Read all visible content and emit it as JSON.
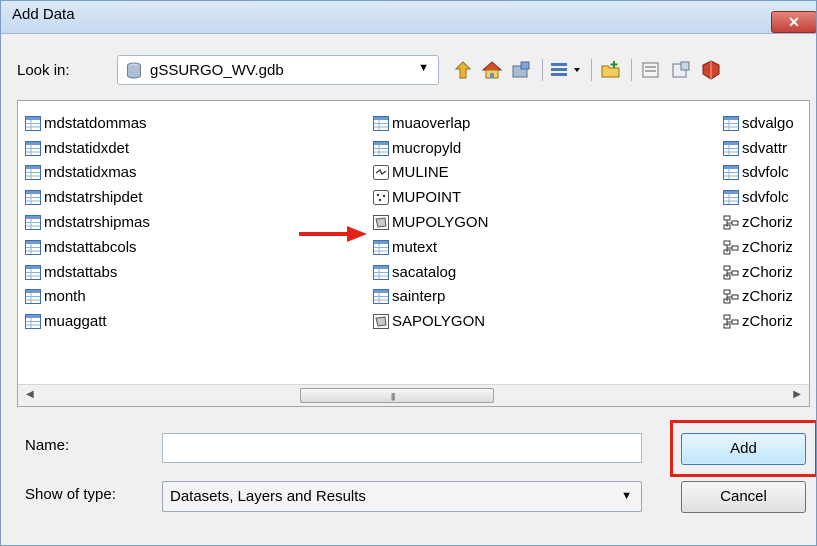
{
  "window": {
    "title": "Add Data",
    "close_glyph": "✕"
  },
  "lookin": {
    "label": "Look in:",
    "value": "gSSURGO_WV.gdb",
    "icon": "geodatabase-icon"
  },
  "toolbar": {
    "icons": [
      "up-one-level-icon",
      "home-icon",
      "connect-folder-icon",
      "view-menu-icon",
      "new-folder-icon",
      "catalog-icon",
      "toggle-contents-icon",
      "arccatalog-icon"
    ]
  },
  "files": {
    "col1": [
      {
        "name": "mdstatdommas",
        "type": "table"
      },
      {
        "name": "mdstatidxdet",
        "type": "table"
      },
      {
        "name": "mdstatidxmas",
        "type": "table"
      },
      {
        "name": "mdstatrshipdet",
        "type": "table"
      },
      {
        "name": "mdstatrshipmas",
        "type": "table"
      },
      {
        "name": "mdstattabcols",
        "type": "table"
      },
      {
        "name": "mdstattabs",
        "type": "table"
      },
      {
        "name": "month",
        "type": "table"
      },
      {
        "name": "muaggatt",
        "type": "table"
      }
    ],
    "col2": [
      {
        "name": "muaoverlap",
        "type": "table"
      },
      {
        "name": "mucropyld",
        "type": "table"
      },
      {
        "name": "MULINE",
        "type": "line"
      },
      {
        "name": "MUPOINT",
        "type": "point"
      },
      {
        "name": "MUPOLYGON",
        "type": "polygon"
      },
      {
        "name": "mutext",
        "type": "table"
      },
      {
        "name": "sacatalog",
        "type": "table"
      },
      {
        "name": "sainterp",
        "type": "table"
      },
      {
        "name": "SAPOLYGON",
        "type": "polygon"
      }
    ],
    "col3": [
      {
        "name": "sdvalgo",
        "type": "table"
      },
      {
        "name": "sdvattr",
        "type": "table"
      },
      {
        "name": "sdvfolc",
        "type": "table"
      },
      {
        "name": "sdvfolc",
        "type": "table"
      },
      {
        "name": "zChoriz",
        "type": "relationship"
      },
      {
        "name": "zChoriz",
        "type": "relationship"
      },
      {
        "name": "zChoriz",
        "type": "relationship"
      },
      {
        "name": "zChoriz",
        "type": "relationship"
      },
      {
        "name": "zChoriz",
        "type": "relationship"
      }
    ]
  },
  "scrollbar": {
    "left_glyph": "◀",
    "right_glyph": "▶",
    "grip_glyph": "|||"
  },
  "name_field": {
    "label": "Name:",
    "value": ""
  },
  "type_field": {
    "label": "Show of type:",
    "value": "Datasets, Layers and Results"
  },
  "buttons": {
    "add": "Add",
    "cancel": "Cancel"
  },
  "colors": {
    "annotation_red": "#e2231a",
    "title_bar": "#c6d9ee"
  }
}
